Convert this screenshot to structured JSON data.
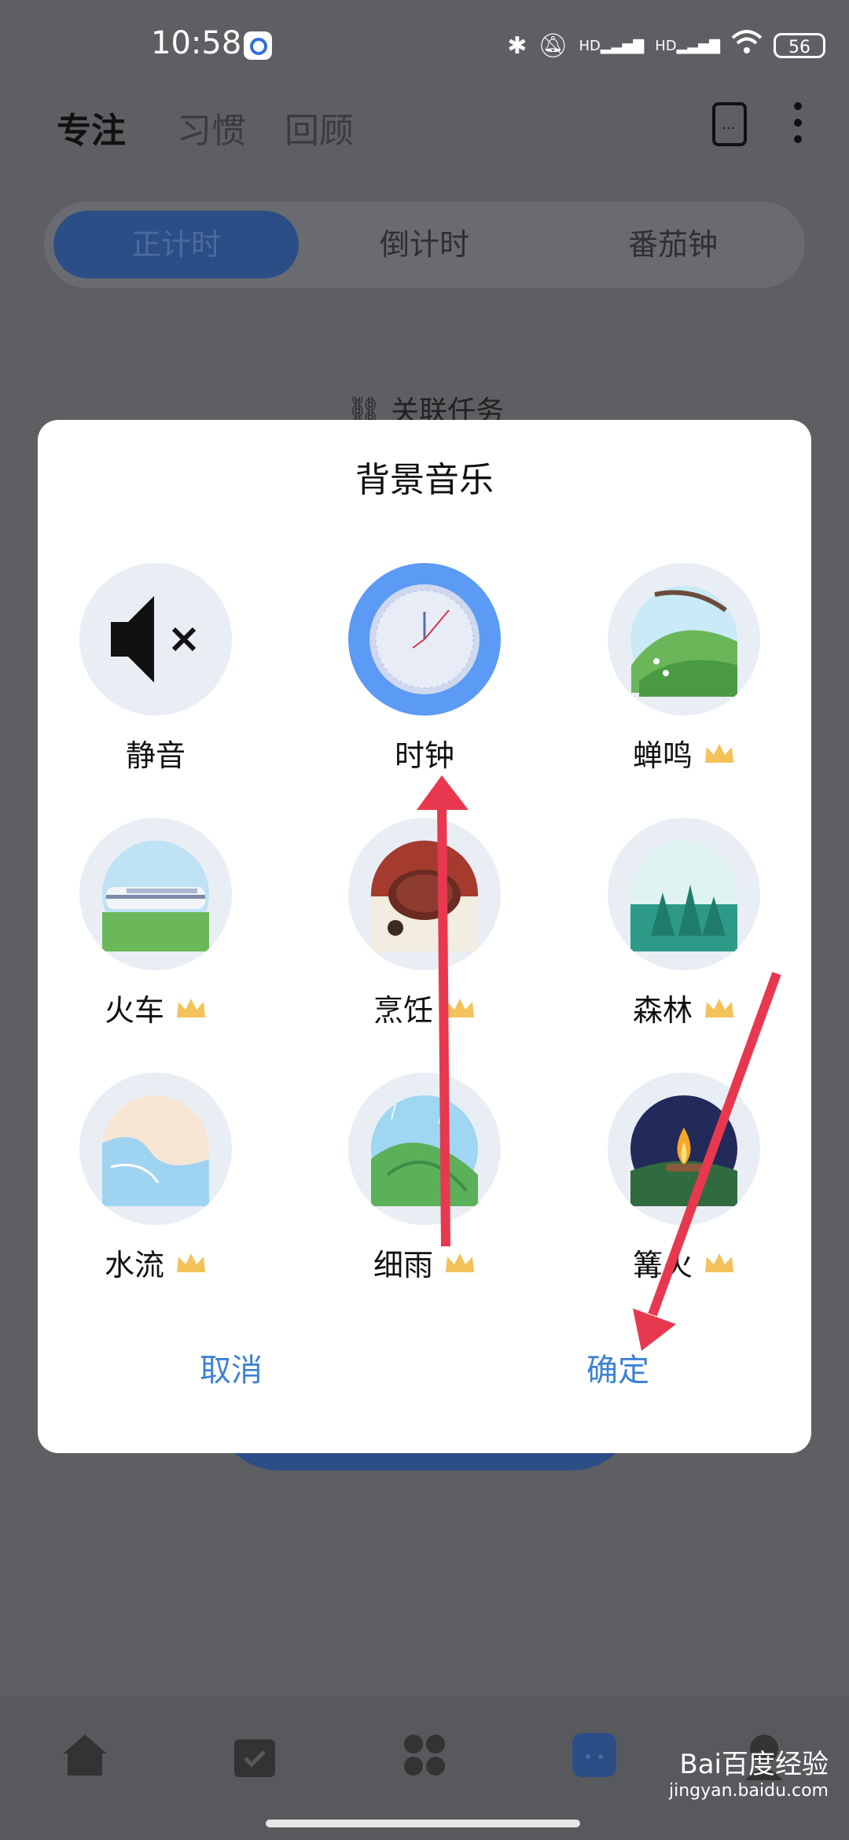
{
  "status_bar": {
    "time": "10:58",
    "battery": "56",
    "hd1": "HD",
    "hd2": "HD"
  },
  "header": {
    "tabs": [
      "专注",
      "习惯",
      "回顾"
    ]
  },
  "segmented": [
    "正计时",
    "倒计时",
    "番茄钟"
  ],
  "link_task": "关联任务",
  "dialog": {
    "title": "背景音乐",
    "items": [
      {
        "label": "静音",
        "icon": "mute-icon"
      },
      {
        "label": "时钟",
        "icon": "clock-icon",
        "selected": true
      },
      {
        "label": "蝉鸣",
        "icon": "cicada-scene-icon",
        "premium": true
      },
      {
        "label": "火车",
        "icon": "train-scene-icon",
        "premium": true
      },
      {
        "label": "烹饪",
        "icon": "cooking-scene-icon",
        "premium": true
      },
      {
        "label": "森林",
        "icon": "forest-scene-icon",
        "premium": true
      },
      {
        "label": "水流",
        "icon": "water-scene-icon",
        "premium": true
      },
      {
        "label": "细雨",
        "icon": "rain-scene-icon",
        "premium": true
      },
      {
        "label": "篝火",
        "icon": "campfire-scene-icon",
        "premium": true
      }
    ],
    "cancel": "取消",
    "confirm": "确定"
  },
  "colors": {
    "accent": "#3d82d4",
    "selected_ring": "#5b9af5",
    "annotation_arrow": "#e8384f",
    "crown": "#f4c25a"
  },
  "watermark": {
    "brand": "Bai百度经验",
    "url": "jingyan.baidu.com"
  }
}
